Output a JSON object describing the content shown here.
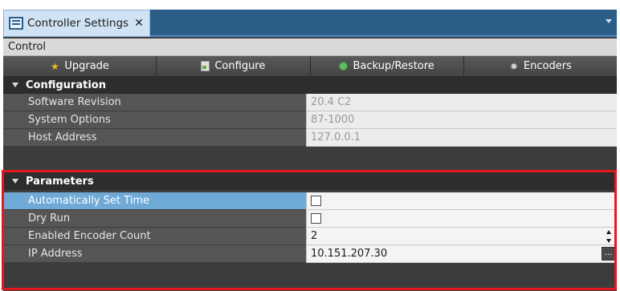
{
  "tab": {
    "title": "Controller Settings",
    "close": "✕"
  },
  "control_bar": {
    "label": "Control"
  },
  "toolbar": {
    "upgrade": "Upgrade",
    "configure": "Configure",
    "backup_restore": "Backup/Restore",
    "encoders": "Encoders"
  },
  "configuration": {
    "header": "Configuration",
    "rows": [
      {
        "label": "Software Revision",
        "value": "20.4 C2"
      },
      {
        "label": "System Options",
        "value": "87-1000"
      },
      {
        "label": "Host Address",
        "value": "127.0.0.1"
      }
    ]
  },
  "parameters": {
    "header": "Parameters",
    "auto_set_time": {
      "label": "Automatically Set Time",
      "checked": false
    },
    "dry_run": {
      "label": "Dry Run",
      "checked": false
    },
    "encoder_count": {
      "label": "Enabled Encoder Count",
      "value": "2"
    },
    "ip_address": {
      "label": "IP Address",
      "value": "10.151.207.30",
      "ellipsis": "..."
    }
  },
  "colors": {
    "highlight_border": "#e3191f",
    "selected_row": "#6fa9d6",
    "tab_bar": "#2c5e8a"
  },
  "icons": {
    "tab": "settings-window-icon",
    "upgrade": "star-icon",
    "configure": "document-icon",
    "backup_restore": "disc-icon",
    "encoders": "gear-icon"
  }
}
